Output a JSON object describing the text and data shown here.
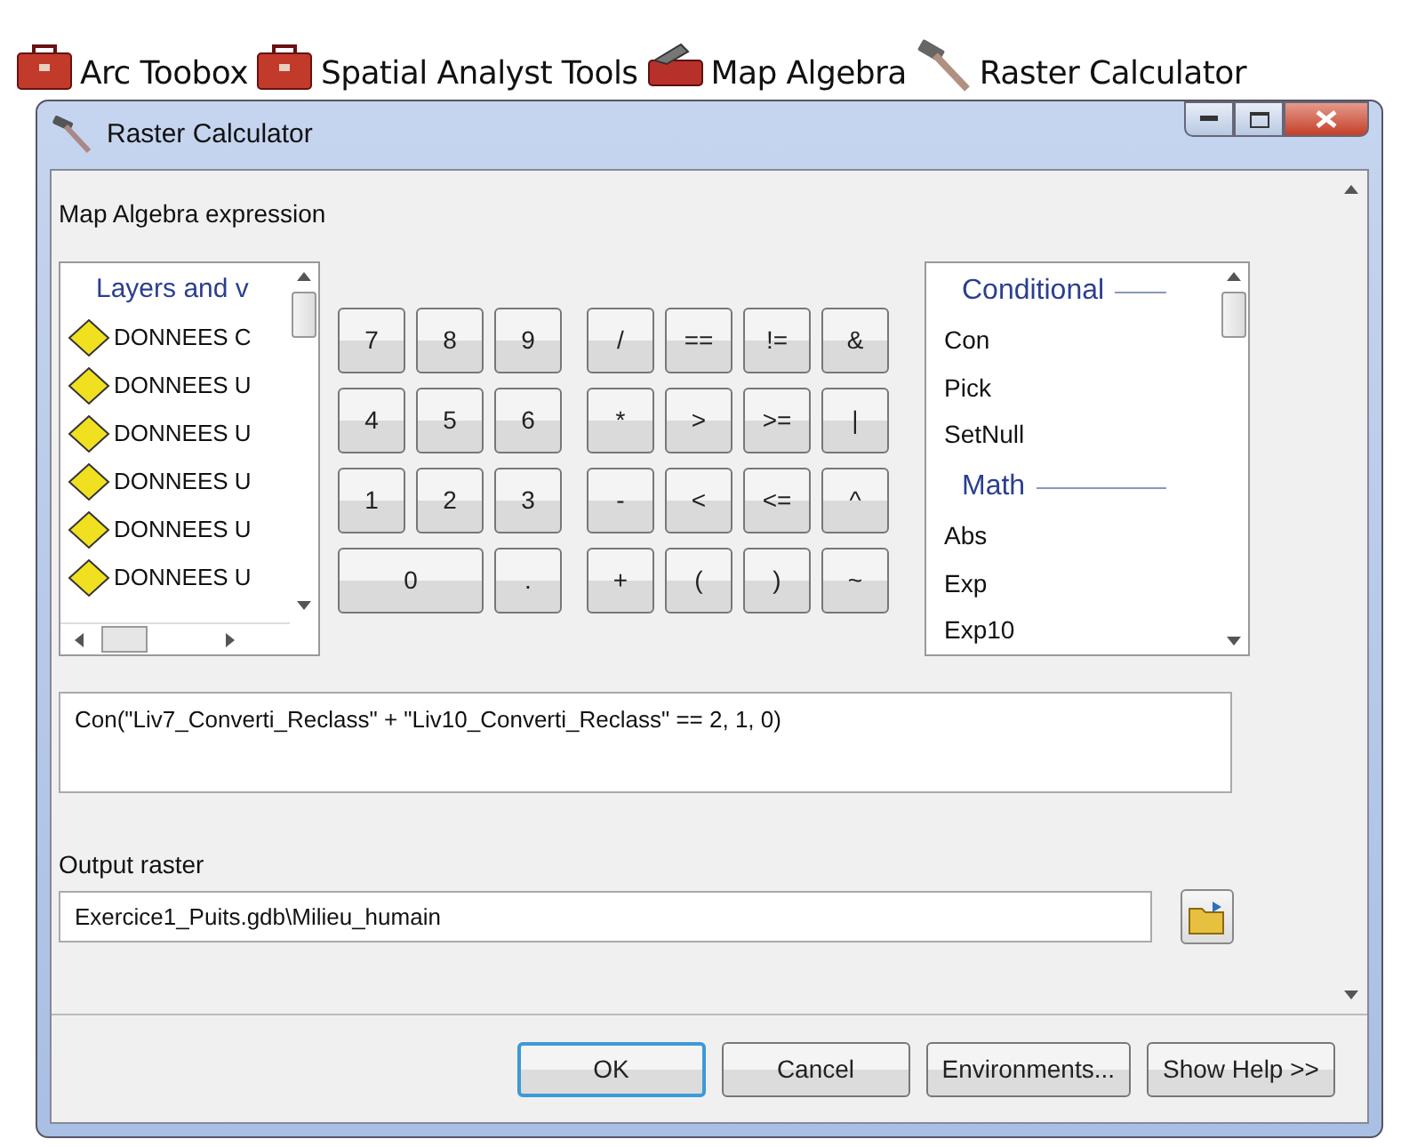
{
  "breadcrumb": [
    {
      "kind": "toolbox",
      "label": "Arc Toobox"
    },
    {
      "kind": "toolbox",
      "label": "Spatial Analyst Tools"
    },
    {
      "kind": "toolset",
      "label": "Map Algebra"
    },
    {
      "kind": "hammer",
      "label": "Raster Calculator"
    }
  ],
  "window": {
    "title": "Raster Calculator"
  },
  "expression_label": "Map Algebra expression",
  "layers": {
    "header": "Layers and v",
    "items": [
      "DONNEES C",
      "DONNEES U",
      "DONNEES U",
      "DONNEES U",
      "DONNEES U",
      "DONNEES U"
    ]
  },
  "number_keys": [
    {
      "label": "7",
      "kind": "normal"
    },
    {
      "label": "8",
      "kind": "normal"
    },
    {
      "label": "9",
      "kind": "normal"
    },
    {
      "label": "4",
      "kind": "normal"
    },
    {
      "label": "5",
      "kind": "normal"
    },
    {
      "label": "6",
      "kind": "normal"
    },
    {
      "label": "1",
      "kind": "normal"
    },
    {
      "label": "2",
      "kind": "normal"
    },
    {
      "label": "3",
      "kind": "normal"
    },
    {
      "label": "0",
      "kind": "wide"
    },
    {
      "label": ".",
      "kind": "normal"
    }
  ],
  "operator_keys": [
    "/",
    "==",
    "!=",
    "&",
    "*",
    ">",
    ">=",
    "|",
    "-",
    "<",
    "<=",
    "^",
    "+",
    "(",
    ")",
    "~"
  ],
  "functions": [
    {
      "group": "Conditional",
      "children": [
        "Con",
        "Pick",
        "SetNull"
      ]
    },
    {
      "group": "Math",
      "children": [
        "Abs",
        "Exp",
        "Exp10"
      ]
    }
  ],
  "expression": "Con(\"Liv7_Converti_Reclass\" + \"Liv10_Converti_Reclass\" == 2, 1, 0)",
  "output_label": "Output raster",
  "output_value": "Exercice1_Puits.gdb\\Milieu_humain",
  "buttons": [
    {
      "label": "OK",
      "default": true
    },
    {
      "label": "Cancel",
      "default": false
    },
    {
      "label": "Environments...",
      "default": false
    },
    {
      "label": "Show Help >>",
      "default": false
    }
  ]
}
